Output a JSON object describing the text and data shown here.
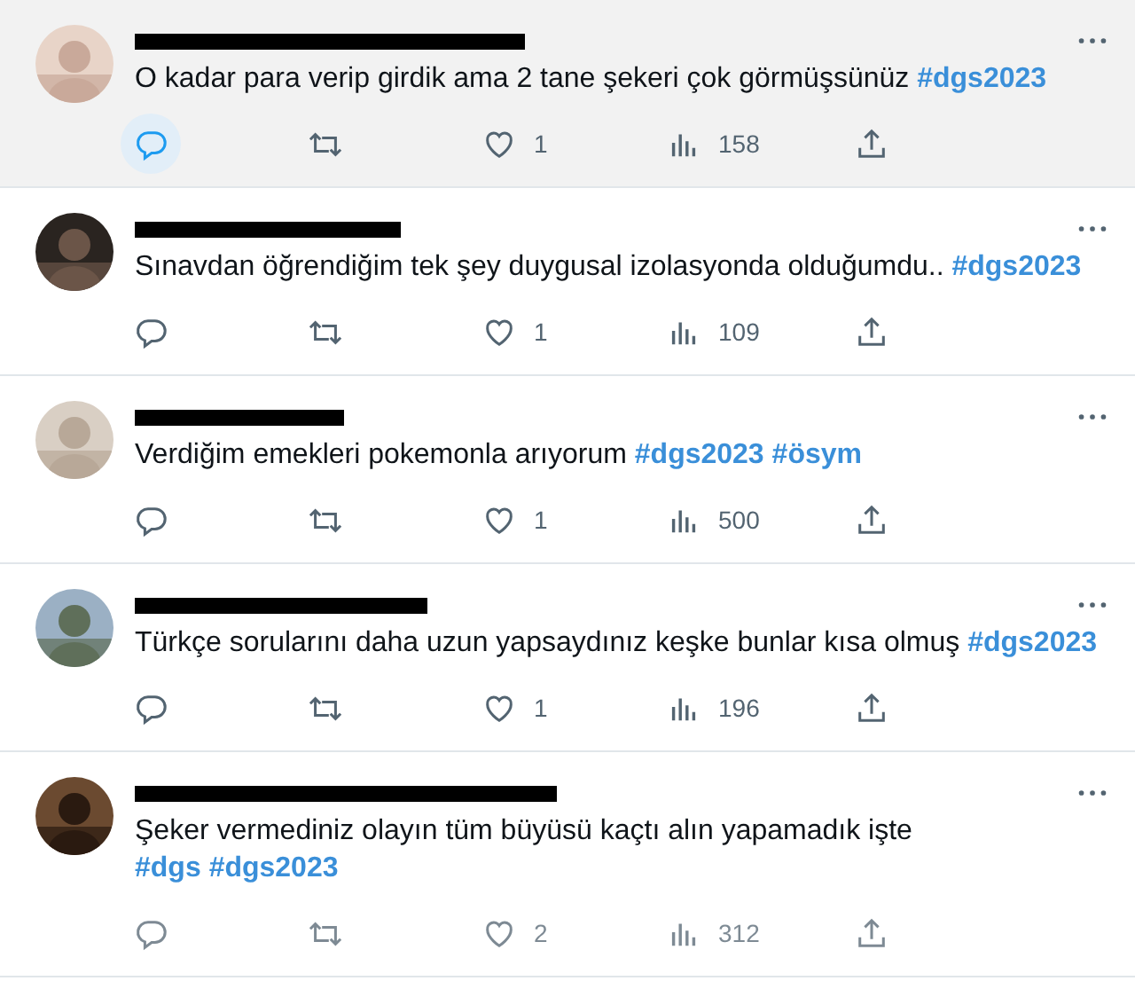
{
  "tweets": [
    {
      "highlighted": true,
      "reply_selected": true,
      "text": [
        {
          "kind": "plain",
          "text": "O kadar para verip girdik ama 2 tane şekeri çok görmüşsünüz "
        },
        {
          "kind": "hashtag",
          "text": "#dgs2023"
        }
      ],
      "likes": "1",
      "views": "158"
    },
    {
      "highlighted": false,
      "reply_selected": false,
      "text": [
        {
          "kind": "plain",
          "text": "Sınavdan öğrendiğim tek şey duygusal izolasyonda olduğumdu.. "
        },
        {
          "kind": "hashtag",
          "text": "#dgs2023"
        }
      ],
      "likes": "1",
      "views": "109"
    },
    {
      "highlighted": false,
      "reply_selected": false,
      "text": [
        {
          "kind": "plain",
          "text": "Verdiğim emekleri pokemonla arıyorum "
        },
        {
          "kind": "hashtag",
          "text": "#dgs2023"
        },
        {
          "kind": "hashtag",
          "text": "#ösym"
        }
      ],
      "likes": "1",
      "views": "500"
    },
    {
      "highlighted": false,
      "reply_selected": false,
      "text": [
        {
          "kind": "plain",
          "text": "Türkçe sorularını daha uzun yapsaydınız keşke bunlar kısa olmuş "
        },
        {
          "kind": "hashtag",
          "text": "#dgs2023"
        }
      ],
      "likes": "1",
      "views": "196"
    },
    {
      "highlighted": false,
      "reply_selected": false,
      "text": [
        {
          "kind": "plain",
          "text": "Şeker vermediniz olayın tüm büyüsü kaçtı alın yapamadık işte "
        },
        {
          "kind": "hashtag",
          "text": "#dgs"
        },
        {
          "kind": "hashtag",
          "text": "#dgs2023"
        }
      ],
      "likes": "2",
      "views": "312"
    }
  ]
}
